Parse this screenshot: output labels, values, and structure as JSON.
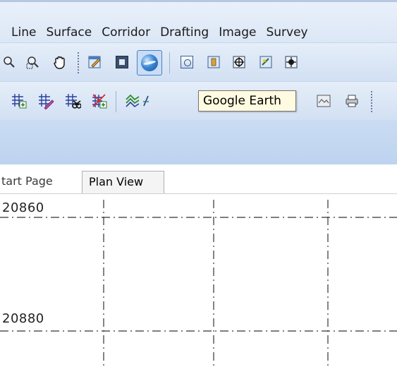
{
  "menu": {
    "items": [
      "Line",
      "Surface",
      "Corridor",
      "Drafting",
      "Image",
      "Survey"
    ]
  },
  "toolbar1": {
    "icons": [
      "zoom-window-icon",
      "zoom-extents-icon",
      "pan-hand-icon",
      "edit-icon",
      "window-icon",
      "google-earth-icon",
      "view-icon-1",
      "view-icon-2",
      "view-icon-3",
      "view-icon-4",
      "view-icon-5"
    ]
  },
  "toolbar2": {
    "icons": [
      "grid-add-icon",
      "grid-edit-icon",
      "grid-delete-icon",
      "grid-settings-icon",
      "contour-icon",
      "profile-icon",
      "print-icon"
    ]
  },
  "tooltip": {
    "text": "Google Earth"
  },
  "tabs": [
    {
      "label": "tart Page"
    },
    {
      "label": "Plan View"
    }
  ],
  "plan_view": {
    "coordinates": [
      "20860",
      "20880"
    ]
  },
  "colors": {
    "menu_bg": "#dce7f6",
    "toolbar_bg": "#d2e0f3",
    "panel_bg": "#bdd3ef",
    "tooltip_bg": "#fffbe0"
  }
}
